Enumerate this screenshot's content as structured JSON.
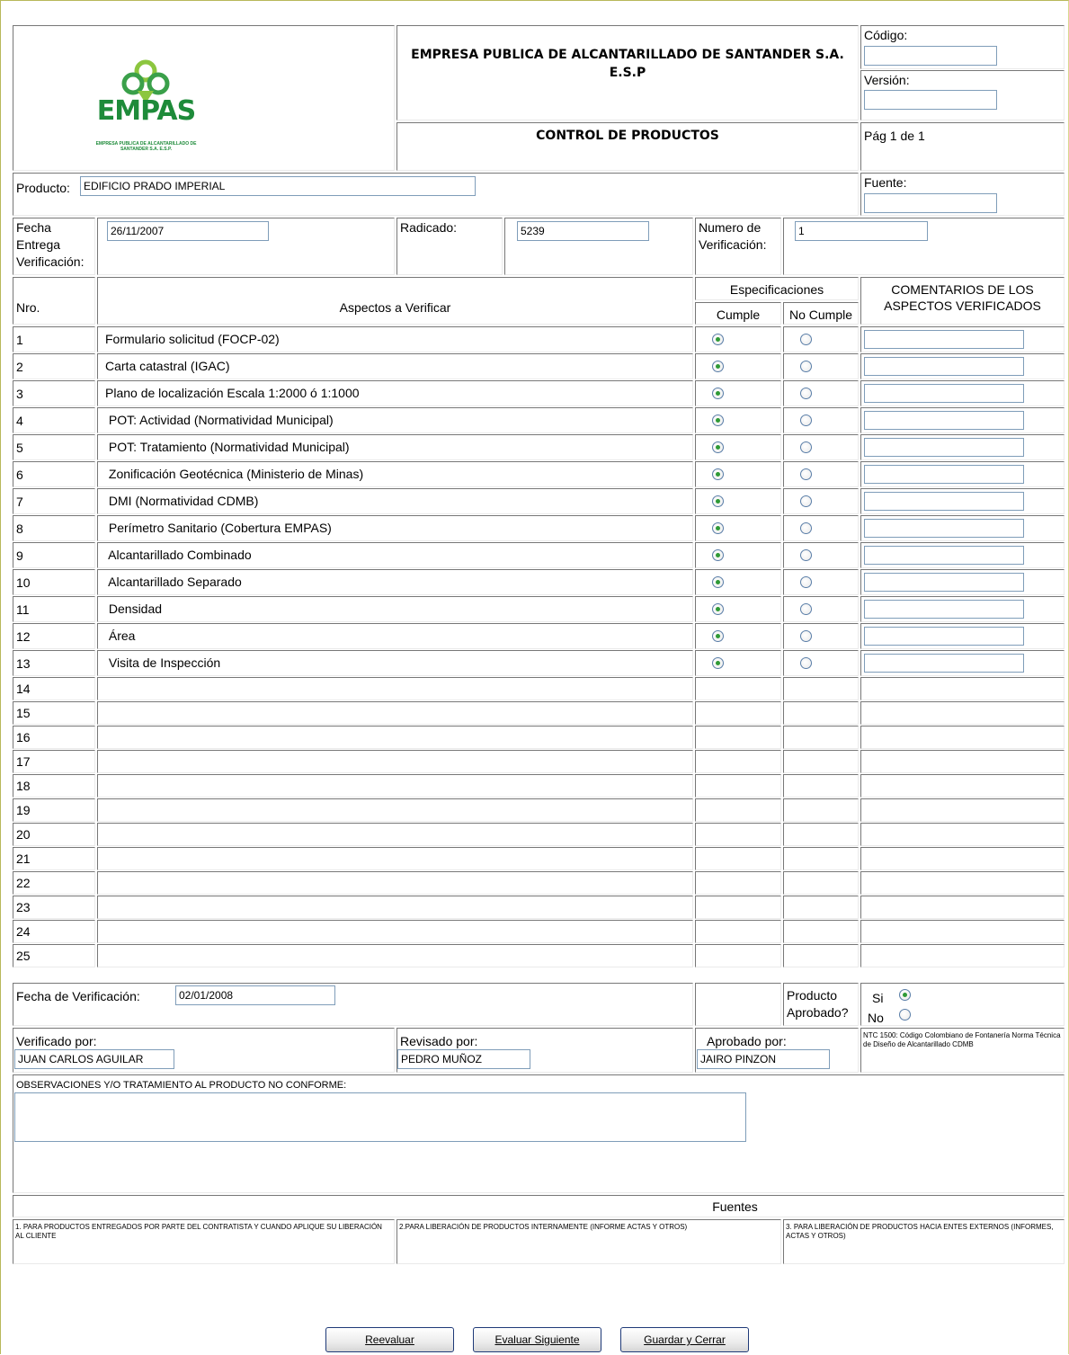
{
  "header": {
    "logo_text": "EMPAS",
    "logo_subtext": "EMPRESA PUBLICA DE ALCANTARILLADO DE SANTANDER S.A. E.S.P.",
    "company_title": "EMPRESA PUBLICA DE ALCANTARILLADO DE SANTANDER S.A. E.S.P",
    "form_title": "CONTROL DE PRODUCTOS",
    "codigo_label": "Código:",
    "codigo_value": "",
    "version_label": "Versión:",
    "version_value": "",
    "page_label": "Pág 1 de 1"
  },
  "producto": {
    "label": "Producto:",
    "value": "EDIFICIO PRADO IMPERIAL"
  },
  "fuente": {
    "label": "Fuente:",
    "value": ""
  },
  "info": {
    "fecha_entrega_label": "Fecha Entrega Verificación:",
    "fecha_entrega_value": "26/11/2007",
    "radicado_label": "Radicado:",
    "radicado_value": "5239",
    "numero_label": "Numero de Verificación:",
    "numero_value": "1"
  },
  "table": {
    "col_nro": "Nro.",
    "col_aspectos": "Aspectos a Verificar",
    "col_especificaciones": "Especificaciones",
    "col_cumple": "Cumple",
    "col_no_cumple": "No Cumple",
    "col_comentarios": "COMENTARIOS DE LOS ASPECTOS VERIFICADOS",
    "rows": [
      {
        "nro": "1",
        "aspecto": "Formulario solicitud (FOCP-02)",
        "cumple": true
      },
      {
        "nro": "2",
        "aspecto": "Carta catastral (IGAC)",
        "cumple": true
      },
      {
        "nro": "3",
        "aspecto": "Plano de localización Escala 1:2000 ó 1:1000",
        "cumple": true
      },
      {
        "nro": "4",
        "aspecto": " POT: Actividad (Normatividad Municipal)",
        "cumple": true
      },
      {
        "nro": "5",
        "aspecto": " POT: Tratamiento (Normatividad Municipal)",
        "cumple": true
      },
      {
        "nro": "6",
        "aspecto": " Zonificación Geotécnica (Ministerio de Minas)",
        "cumple": true
      },
      {
        "nro": "7",
        "aspecto": " DMI (Normatividad CDMB)",
        "cumple": true
      },
      {
        "nro": "8",
        "aspecto": " Perímetro Sanitario (Cobertura EMPAS)",
        "cumple": true
      },
      {
        "nro": "9",
        "aspecto": " Alcantarillado Combinado",
        "cumple": true
      },
      {
        "nro": "10",
        "aspecto": " Alcantarillado Separado",
        "cumple": true
      },
      {
        "nro": "11",
        "aspecto": " Densidad",
        "cumple": true
      },
      {
        "nro": "12",
        "aspecto": " Área",
        "cumple": true
      },
      {
        "nro": "13",
        "aspecto": " Visita de Inspección",
        "cumple": true
      }
    ],
    "empty_rows": [
      "14",
      "15",
      "16",
      "17",
      "18",
      "19",
      "20",
      "21",
      "22",
      "23",
      "24",
      "25"
    ]
  },
  "verificacion": {
    "fecha_label": "Fecha  de Verificación:",
    "fecha_value": "02/01/2008",
    "aprobado_question": "Producto Aprobado?",
    "si_label": "Si",
    "no_label": "No",
    "aprobado": true
  },
  "firmas": {
    "verificado_label": "Verificado por:",
    "verificado_value": "JUAN CARLOS AGUILAR",
    "revisado_label": "Revisado por:",
    "revisado_value": "PEDRO MUÑOZ",
    "aprobado_label": "Aprobado por:",
    "aprobado_value": "JAIRO PINZON",
    "ntc_note": "NTC 1500: Código Colombiano de Fontanería Norma Técnica de Diseño de Alcantarillado CDMB"
  },
  "observaciones": {
    "label": "OBSERVACIONES Y/O TRATAMIENTO AL PRODUCTO NO CONFORME:",
    "value": ""
  },
  "fuentes": {
    "title": "Fuentes",
    "items": [
      "1. PARA PRODUCTOS ENTREGADOS POR PARTE DEL CONTRATISTA Y CUANDO APLIQUE SU LIBERACIÓN AL CLIENTE",
      "2.PARA LIBERACIÓN DE PRODUCTOS INTERNAMENTE (INFORME ACTAS Y OTROS)",
      "3. PARA LIBERACIÓN DE PRODUCTOS HACIA ENTES EXTERNOS (INFORMES, ACTAS Y OTROS)"
    ]
  },
  "buttons": {
    "reevaluar": "Reevaluar",
    "evaluar_siguiente": "Evaluar Siguiente",
    "guardar_cerrar": "Guardar y Cerrar"
  },
  "colors": {
    "logo_green": "#1e8b3a",
    "radio_green": "#2f9a36",
    "input_border": "#7f9db9",
    "button_border": "#1f3a78"
  }
}
